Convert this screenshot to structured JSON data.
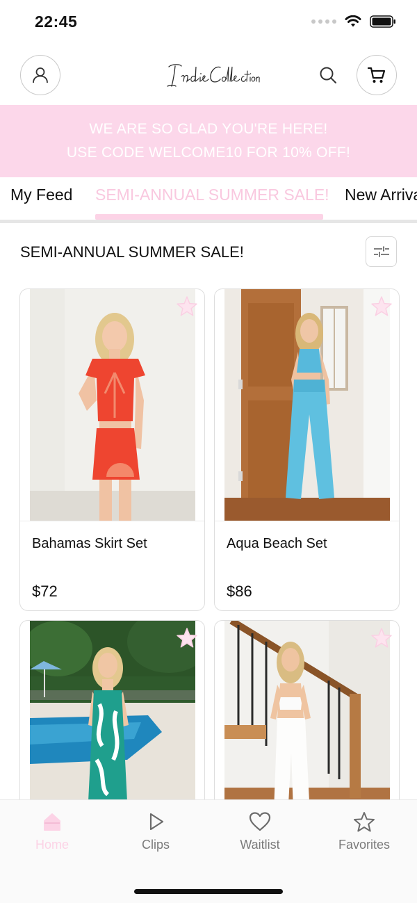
{
  "status_bar": {
    "time": "22:45"
  },
  "header": {
    "logo_text": "Indie Collection"
  },
  "promo": {
    "line1": "WE ARE SO GLAD YOU'RE HERE!",
    "line2": "USE CODE WELCOME10 FOR 10% OFF!"
  },
  "tabs": {
    "items": [
      {
        "label": "My Feed"
      },
      {
        "label": "SEMI-ANNUAL SUMMER SALE!",
        "active": true
      },
      {
        "label": "New Arrivals"
      }
    ]
  },
  "section": {
    "title": "SEMI-ANNUAL SUMMER SALE!"
  },
  "products": [
    {
      "name": "Bahamas Skirt Set",
      "price": "$72"
    },
    {
      "name": "Aqua Beach Set",
      "price": "$86"
    },
    {
      "name": "",
      "price": ""
    },
    {
      "name": "",
      "price": ""
    }
  ],
  "bottom_nav": {
    "items": [
      {
        "label": "Home",
        "icon": "home-icon",
        "active": true
      },
      {
        "label": "Clips",
        "icon": "play-icon"
      },
      {
        "label": "Waitlist",
        "icon": "heart-icon"
      },
      {
        "label": "Favorites",
        "icon": "star-icon"
      }
    ]
  },
  "colors": {
    "accent_pink": "#fcd7ea",
    "active_tab_text": "#f9c8df",
    "text": "#111111",
    "muted": "#7a7a7a"
  }
}
